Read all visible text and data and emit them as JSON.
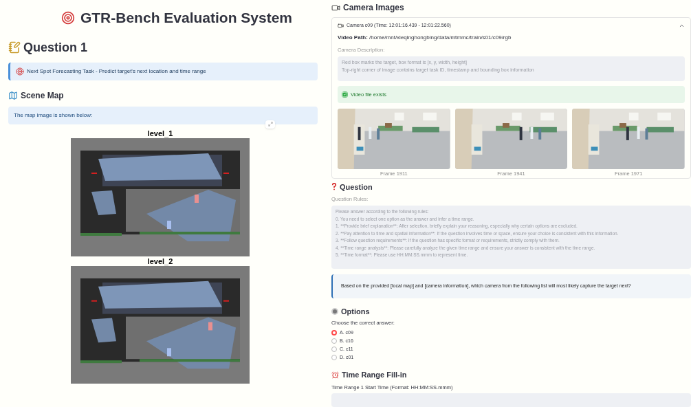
{
  "title": "GTR-Bench Evaluation System",
  "question": {
    "heading": "Question 1",
    "task": "Next Spot Forecasting Task - Predict target's next location and time range"
  },
  "scene_map": {
    "heading": "Scene Map",
    "note": "The map image is shown below:",
    "levels": [
      {
        "title": "level_1"
      },
      {
        "title": "level_2"
      }
    ]
  },
  "camera_images": {
    "heading": "Camera Images",
    "expander": {
      "title": "Camera c09 (Time: 12:01:16.439 - 12:01:22.560)",
      "expanded": true,
      "video_path_label": "Video Path:",
      "video_path": "/home/mnt/xieqinghongbing/data/mtmmc/train/s01/c09/rgb",
      "description_label": "Camera Description:",
      "description": [
        "Red box marks the target, box format is [x, y, width, height]",
        "Top-right corner of image contains target task ID, timestamp and bounding box information"
      ],
      "status": "Video file exists",
      "frames": [
        {
          "caption": "Frame 1911"
        },
        {
          "caption": "Frame 1941"
        },
        {
          "caption": "Frame 1971"
        }
      ]
    }
  },
  "question_panel": {
    "heading": "Question",
    "rules_label": "Question Rules:",
    "rules": [
      "Please answer according to the following rules:",
      "0. You need to select one option as the answer and infer a time range.",
      "1. **Provide brief explanation**: After selection, briefly explain your reasoning, especially why certain options are excluded.",
      "2. **Pay attention to time and spatial information**: If the question involves time or space, ensure your choice is consistent with this information.",
      "3. **Follow question requirements**: If the question has specific format or requirements, strictly comply with them.",
      "4. **Time range analysis**: Please carefully analyze the given time range and ensure your answer is consistent with the time range.",
      "5. **Time format**: Please use HH:MM:SS.mmm to represent time."
    ],
    "prompt": "Based on the provided [local map] and [camera information], which camera from the following list will most likely capture the target next?"
  },
  "options": {
    "heading": "Options",
    "label": "Choose the correct answer:",
    "items": [
      {
        "label": "A. c09",
        "selected": true
      },
      {
        "label": "B. c16",
        "selected": false
      },
      {
        "label": "C. c11",
        "selected": false
      },
      {
        "label": "D. c01",
        "selected": false
      }
    ]
  },
  "time_range": {
    "heading": "Time Range Fill-in",
    "field_label": "Time Range 1 Start Time (Format: HH:MM:SS.mmm)"
  }
}
